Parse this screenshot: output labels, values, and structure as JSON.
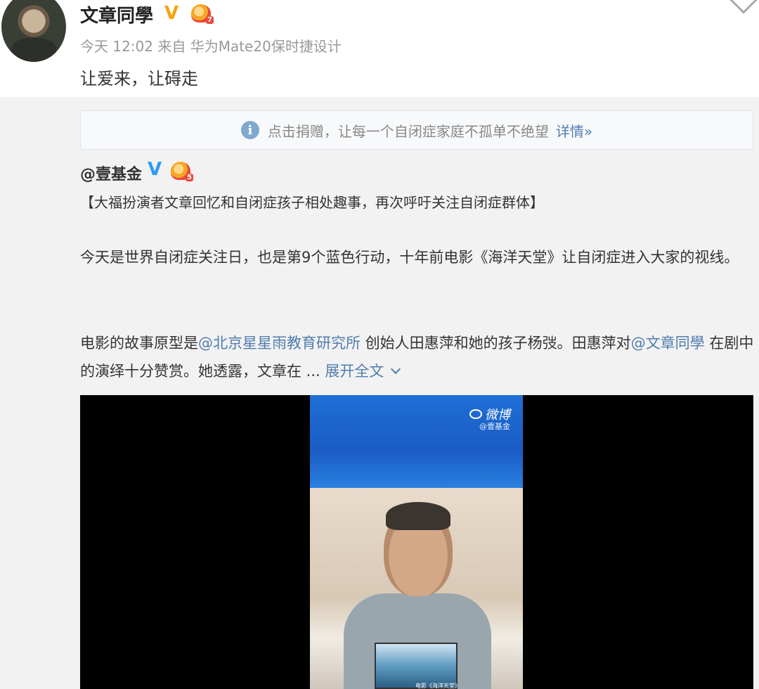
{
  "post": {
    "author": "文章同學",
    "verified_badge": "V",
    "meta": "今天 12:02 来自 华为Mate20保时捷设计",
    "text": "让爱来，让碍走"
  },
  "banner": {
    "info_glyph": "i",
    "text": "点击捐赠，让每一个自闭症家庭不孤单不绝望",
    "link": "详情»"
  },
  "repost": {
    "author": "@壹基金",
    "verified_badge": "V",
    "title": "【大福扮演者文章回忆和自闭症孩子相处趣事，再次呼吁关注自闭症群体】",
    "para1": "今天是世界自闭症关注日，也是第9个蓝色行动，十年前电影《海洋天堂》让自闭症进入大家的视线。",
    "para2": {
      "t1": "电影的故事原型是",
      "mention1": "@北京星星雨教育研究所",
      "t2": " 创始人田惠萍和她的孩子杨弢。田惠萍对",
      "mention2": "@文章同學",
      "t3": " 在剧中的演绎十分赞赏。她透露，文章在 ... ",
      "expand": "展开全文"
    }
  },
  "video": {
    "watermark": "微博",
    "watermark_sub": "@壹基金",
    "screen_caption": "电影《海洋天堂》"
  },
  "badges": {
    "post_crown_level": "7",
    "repost_crown_level": "5"
  },
  "colors": {
    "link": "#507daf",
    "gold_v": "#f4a20b",
    "blue_v": "#2f9bf2"
  }
}
